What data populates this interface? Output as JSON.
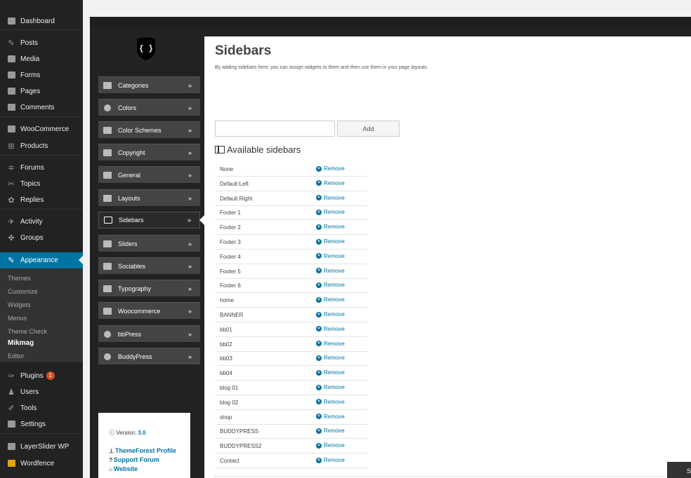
{
  "admin_menu": {
    "items": [
      {
        "label": "Dashboard",
        "icon": "dashboard-icon"
      },
      {
        "label": "Posts",
        "icon": "pin-icon"
      },
      {
        "label": "Media",
        "icon": "media-icon"
      },
      {
        "label": "Forms",
        "icon": "forms-icon"
      },
      {
        "label": "Pages",
        "icon": "pages-icon"
      },
      {
        "label": "Comments",
        "icon": "comment-icon"
      },
      {
        "label": "WooCommerce",
        "icon": "woocommerce-icon"
      },
      {
        "label": "Products",
        "icon": "cart-icon"
      },
      {
        "label": "Forums",
        "icon": "forums-icon"
      },
      {
        "label": "Topics",
        "icon": "topics-icon"
      },
      {
        "label": "Replies",
        "icon": "replies-icon"
      },
      {
        "label": "Activity",
        "icon": "activity-icon"
      },
      {
        "label": "Groups",
        "icon": "groups-icon"
      },
      {
        "label": "Appearance",
        "icon": "brush-icon"
      },
      {
        "label": "Plugins",
        "icon": "plugin-icon",
        "badge": "1"
      },
      {
        "label": "Users",
        "icon": "users-icon"
      },
      {
        "label": "Tools",
        "icon": "tools-icon"
      },
      {
        "label": "Settings",
        "icon": "settings-icon"
      },
      {
        "label": "LayerSlider WP",
        "icon": "layerslider-icon"
      },
      {
        "label": "Wordfence",
        "icon": "wordfence-icon"
      }
    ],
    "submenu": [
      "Themes",
      "Customize",
      "Widgets",
      "Menus",
      "Theme Check",
      "Mikmag",
      "Editor"
    ],
    "current_submenu": "Mikmag"
  },
  "options": {
    "logo": "{ }",
    "nav": [
      {
        "label": "Categories",
        "icon": "categories-icon"
      },
      {
        "label": "Colors",
        "icon": "colors-icon"
      },
      {
        "label": "Color Schemes",
        "icon": "color-schemes-icon"
      },
      {
        "label": "Copyright",
        "icon": "tag-icon"
      },
      {
        "label": "General",
        "icon": "cogs-icon"
      },
      {
        "label": "Layouts",
        "icon": "layouts-icon"
      },
      {
        "label": "Sidebars",
        "icon": "sidebars-icon"
      },
      {
        "label": "Sliders",
        "icon": "image-icon"
      },
      {
        "label": "Sociables",
        "icon": "twitter-icon"
      },
      {
        "label": "Typography",
        "icon": "typography-icon"
      },
      {
        "label": "Woocommerce",
        "icon": "cart-icon"
      },
      {
        "label": "bbPress",
        "icon": "bbpress-icon"
      },
      {
        "label": "BuddyPress",
        "icon": "buddypress-icon"
      }
    ],
    "active_nav": "Sidebars",
    "chevron": "»",
    "version_label": "Version:",
    "version": "3.0",
    "links": [
      "ThemeForest Profile",
      "Support Forum",
      "Website"
    ]
  },
  "main": {
    "title": "Sidebars",
    "description": "By adding sidebars here, you can assign widgets to them and then use them in your page layouts.",
    "input_value": "",
    "add_label": "Add",
    "available_heading": "Available sidebars",
    "remove_label": "Remove",
    "sidebars": [
      "None",
      "Default Left",
      "Default Right",
      "Footer 1",
      "Footer 2",
      "Footer 3",
      "Footer 4",
      "Footer 5",
      "Footer 6",
      "home",
      "BANNER",
      "bb01",
      "bb02",
      "bb03",
      "bb04",
      "blog 01",
      "blog 02",
      "shop",
      "BUDDYPRESS",
      "BUDDYPRESS2",
      "Contact"
    ]
  },
  "save_tab": "S",
  "colors": {
    "accent": "#0074a2",
    "menu_bg": "#222222",
    "badge": "#d54e21"
  }
}
